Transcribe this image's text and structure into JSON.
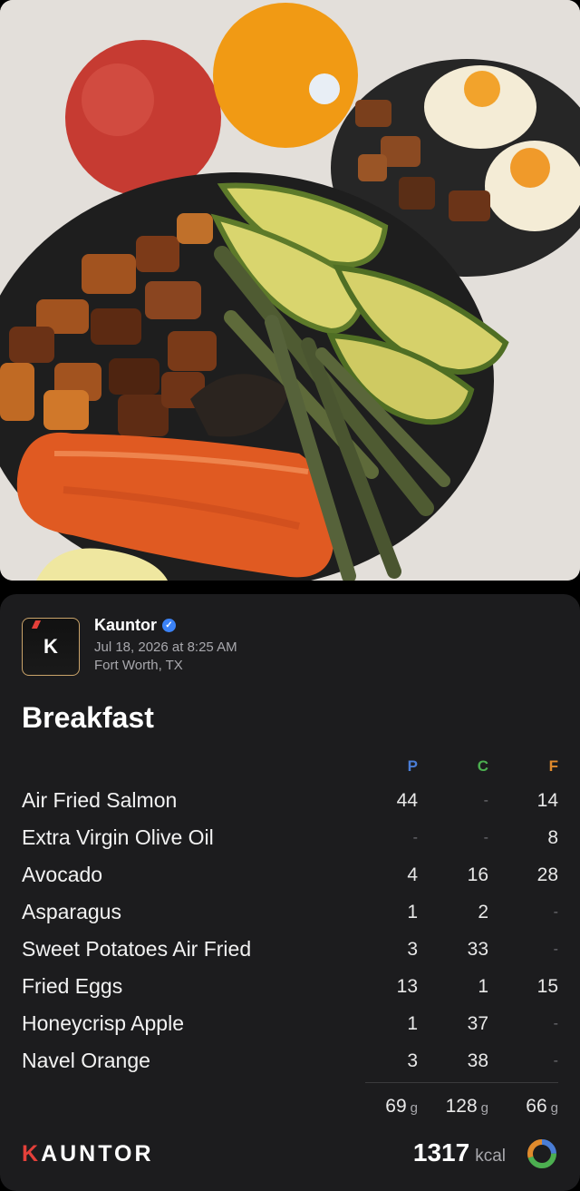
{
  "post": {
    "author": "Kauntor",
    "date": "Jul 18, 2026 at 8:25 AM",
    "location": "Fort Worth, TX",
    "logo_letter": "K"
  },
  "meal": {
    "title": "Breakfast",
    "columns": {
      "p": "P",
      "c": "C",
      "f": "F"
    },
    "items": [
      {
        "name": "Air Fried Salmon",
        "p": "44",
        "c": "-",
        "f": "14"
      },
      {
        "name": "Extra Virgin Olive Oil",
        "p": "-",
        "c": "-",
        "f": "8"
      },
      {
        "name": "Avocado",
        "p": "4",
        "c": "16",
        "f": "28"
      },
      {
        "name": "Asparagus",
        "p": "1",
        "c": "2",
        "f": "-"
      },
      {
        "name": "Sweet Potatoes Air Fried",
        "p": "3",
        "c": "33",
        "f": "-"
      },
      {
        "name": "Fried Eggs",
        "p": "13",
        "c": "1",
        "f": "15"
      },
      {
        "name": "Honeycrisp Apple",
        "p": "1",
        "c": "37",
        "f": "-"
      },
      {
        "name": "Navel Orange",
        "p": "3",
        "c": "38",
        "f": "-"
      }
    ],
    "totals": {
      "p": "69",
      "c": "128",
      "f": "66",
      "unit": "g"
    },
    "calories": "1317",
    "calories_unit": "kcal"
  },
  "brand": {
    "name": "KAUNTOR"
  },
  "colors": {
    "protein": "#4a7dd6",
    "carbs": "#4caf50",
    "fat": "#e08a2c",
    "brand_red": "#e4403a"
  },
  "icons": {
    "verified": "verified-check-icon",
    "macro_ring": "macro-ring-icon"
  }
}
